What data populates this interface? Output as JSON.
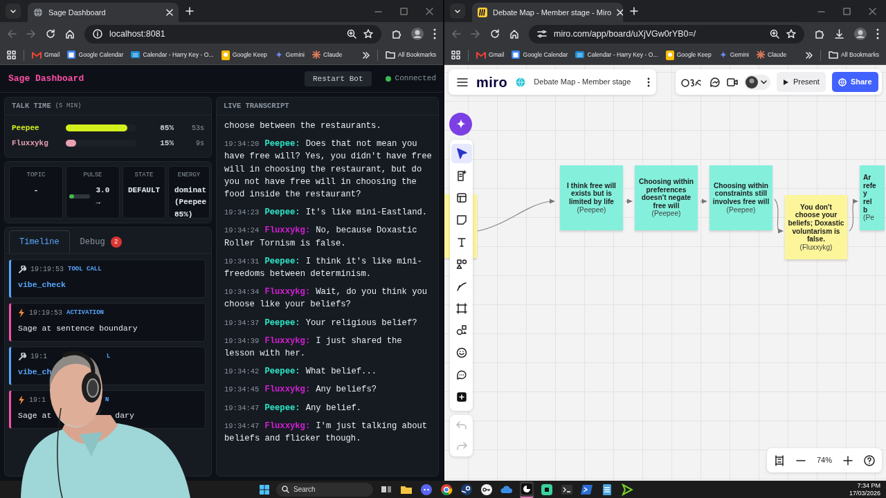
{
  "browsers": [
    {
      "tab_title": "Sage Dashboard",
      "favicon": {
        "kind": "globe"
      },
      "site_icon": {
        "kind": "info"
      },
      "url": "localhost:8081",
      "download_button": false,
      "bookmarks": [
        {
          "kind": "gmail",
          "label": "Gmail"
        },
        {
          "kind": "calendar",
          "label": "Google Calendar"
        },
        {
          "kind": "outlook",
          "label": "Calendar - Harry Key - O..."
        },
        {
          "kind": "keep",
          "label": "Google Keep"
        },
        {
          "kind": "gemini",
          "label": "Gemini"
        },
        {
          "kind": "claude",
          "label": "Claude"
        }
      ],
      "all_bookmarks": "All Bookmarks"
    },
    {
      "tab_title": "Debate Map - Member stage - Miro",
      "favicon": {
        "kind": "miro"
      },
      "site_icon": {
        "kind": "tune"
      },
      "url": "miro.com/app/board/uXjVGw0rYB0=/",
      "download_button": true,
      "bookmarks": [
        {
          "kind": "gmail",
          "label": "Gmail"
        },
        {
          "kind": "calendar",
          "label": "Google Calendar"
        },
        {
          "kind": "outlook",
          "label": "Calendar - Harry Key - O..."
        },
        {
          "kind": "keep",
          "label": "Google Keep"
        },
        {
          "kind": "gemini",
          "label": "Gemini"
        },
        {
          "kind": "claude",
          "label": "Claude"
        }
      ],
      "all_bookmarks": "All Bookmarks"
    }
  ],
  "dashboard": {
    "title": "Sage Dashboard",
    "restart_button": "Restart Bot",
    "status": "Connected",
    "connected": true,
    "talk_time": {
      "title": "TALK TIME",
      "window": "(5 MIN)",
      "speakers": [
        {
          "name": "Peepee",
          "color": "#d4f01c",
          "level": 0.87,
          "percent": "85%",
          "seconds": "53s"
        },
        {
          "name": "Fluxxykg",
          "color": "#e8a0b0",
          "level": 0.15,
          "percent": "15%",
          "seconds": "9s"
        }
      ]
    },
    "stats": [
      {
        "kind": "text",
        "label": "TOPIC",
        "value": "-"
      },
      {
        "kind": "pulse",
        "label": "PULSE",
        "level": 0.22,
        "value": "3.0 →"
      },
      {
        "kind": "text",
        "label": "STATE",
        "value": "DEFAULT"
      },
      {
        "kind": "wrap",
        "label": "ENERGY",
        "value": "dominat (Peepee 85%)"
      }
    ],
    "tabs": [
      {
        "label": "Timeline",
        "selected": true
      },
      {
        "label": "Debug",
        "selected": false,
        "badge": "2"
      }
    ],
    "timeline": [
      {
        "kind": "tool_call",
        "occluded": false,
        "time": "19:19:53",
        "label": "TOOL CALL",
        "text": "vibe_check"
      },
      {
        "kind": "activation",
        "occluded": false,
        "time": "19:19:53",
        "label": "ACTIVATION",
        "text": "Sage at sentence boundary"
      },
      {
        "kind": "tool_call",
        "occluded": true,
        "time": "19:1",
        "label": "L",
        "text": "vibe_ch"
      },
      {
        "kind": "activation",
        "occluded": true,
        "time": "19:1",
        "label": "N",
        "text": "Sage at",
        "text_tail": "dary"
      }
    ],
    "transcript": {
      "title": "LIVE TRANSCRIPT",
      "entries": [
        {
          "kind": "continuation",
          "text": "choose between the restaurants."
        },
        {
          "kind": "line",
          "time": "19:34:20",
          "speaker": "Peepee:",
          "color": "#2fe6c8",
          "text": "Does that not mean you have free will? Yes, you didn't have free will in choosing the restaurant, but do you not have free will in choosing the food inside the restaurant?"
        },
        {
          "kind": "line",
          "time": "19:34:23",
          "speaker": "Peepee:",
          "color": "#2fe6c8",
          "text": "It's like mini-Eastland."
        },
        {
          "kind": "line",
          "time": "19:34:24",
          "speaker": "Fluxxykg:",
          "color": "#d41fd4",
          "text": "No, because Doxastic Roller Tornism is false."
        },
        {
          "kind": "line",
          "time": "19:34:31",
          "speaker": "Peepee:",
          "color": "#2fe6c8",
          "text": "I think it's like mini-freedoms between determinism."
        },
        {
          "kind": "line",
          "time": "19:34:34",
          "speaker": "Fluxxykg:",
          "color": "#d41fd4",
          "text": "Wait, do you think you choose like your beliefs?"
        },
        {
          "kind": "line",
          "time": "19:34:37",
          "speaker": "Peepee:",
          "color": "#2fe6c8",
          "text": "Your religious belief?"
        },
        {
          "kind": "line",
          "time": "19:34:39",
          "speaker": "Fluxxykg:",
          "color": "#d41fd4",
          "text": "I just shared the lesson with her."
        },
        {
          "kind": "line",
          "time": "19:34:42",
          "speaker": "Peepee:",
          "color": "#2fe6c8",
          "text": "What belief..."
        },
        {
          "kind": "line",
          "time": "19:34:45",
          "speaker": "Fluxxykg:",
          "color": "#d41fd4",
          "text": "Any beliefs?"
        },
        {
          "kind": "line",
          "time": "19:34:47",
          "speaker": "Peepee:",
          "color": "#2fe6c8",
          "text": "Any belief."
        },
        {
          "kind": "line",
          "time": "19:34:47",
          "speaker": "Fluxxykg:",
          "color": "#d41fd4",
          "text": "I'm just talking about beliefs and flicker though."
        }
      ]
    }
  },
  "miro": {
    "logo": "miro",
    "board_title": "Debate Map - Member stage",
    "present": "Present",
    "share": "Share",
    "zoom": "74%",
    "tools": [
      {
        "kind": "select",
        "selected": true
      },
      {
        "kind": "template",
        "selected": false
      },
      {
        "kind": "layout",
        "selected": false
      },
      {
        "kind": "sticky",
        "selected": false
      },
      {
        "kind": "text",
        "selected": false
      },
      {
        "kind": "shapes",
        "selected": false
      },
      {
        "kind": "pen",
        "selected": false
      },
      {
        "kind": "frame",
        "selected": false
      },
      {
        "kind": "diagram",
        "selected": false
      },
      {
        "kind": "sticker",
        "selected": false
      },
      {
        "kind": "comment",
        "selected": false
      },
      {
        "kind": "add",
        "selected": false
      }
    ],
    "stickies": [
      {
        "kind": "cut_left",
        "color": "#fdf59a"
      },
      {
        "kind": "full",
        "color": "#84f0dc",
        "text": "I think free will exists but is limited by life",
        "author": "(Peepee)"
      },
      {
        "kind": "full",
        "color": "#84f0dc",
        "text": "Choosing within preferences doesn't negate free will",
        "author": "(Peepee)"
      },
      {
        "kind": "full",
        "color": "#84f0dc",
        "text": "Choosing within constraints still involves free will",
        "author": "(Peepee)"
      },
      {
        "kind": "full",
        "color": "#fdf59a",
        "text": "You don't choose your beliefs; Doxastic voluntarism is false.",
        "author": "(Fluxxykg)"
      },
      {
        "kind": "cut_right",
        "color": "#84f0dc",
        "lines": [
          "Ar",
          "refe",
          "y",
          "rel",
          "b"
        ],
        "author": "(Pe"
      }
    ]
  },
  "taskbar": {
    "search": "Search",
    "time": "7:34 PM",
    "date": "17/03/2026",
    "apps": [
      {
        "kind": "taskview",
        "active": false
      },
      {
        "kind": "folder",
        "active": false
      },
      {
        "kind": "chat",
        "active": false
      },
      {
        "kind": "browser",
        "active": false
      },
      {
        "kind": "steam",
        "active": false
      },
      {
        "kind": "key",
        "active": false
      },
      {
        "kind": "cloud",
        "active": false
      },
      {
        "kind": "pie",
        "active": true
      },
      {
        "kind": "cube",
        "active": false
      },
      {
        "kind": "terminal",
        "active": false
      },
      {
        "kind": "shell",
        "active": false
      },
      {
        "kind": "notepad",
        "active": false
      },
      {
        "kind": "arrow",
        "active": false
      }
    ]
  }
}
